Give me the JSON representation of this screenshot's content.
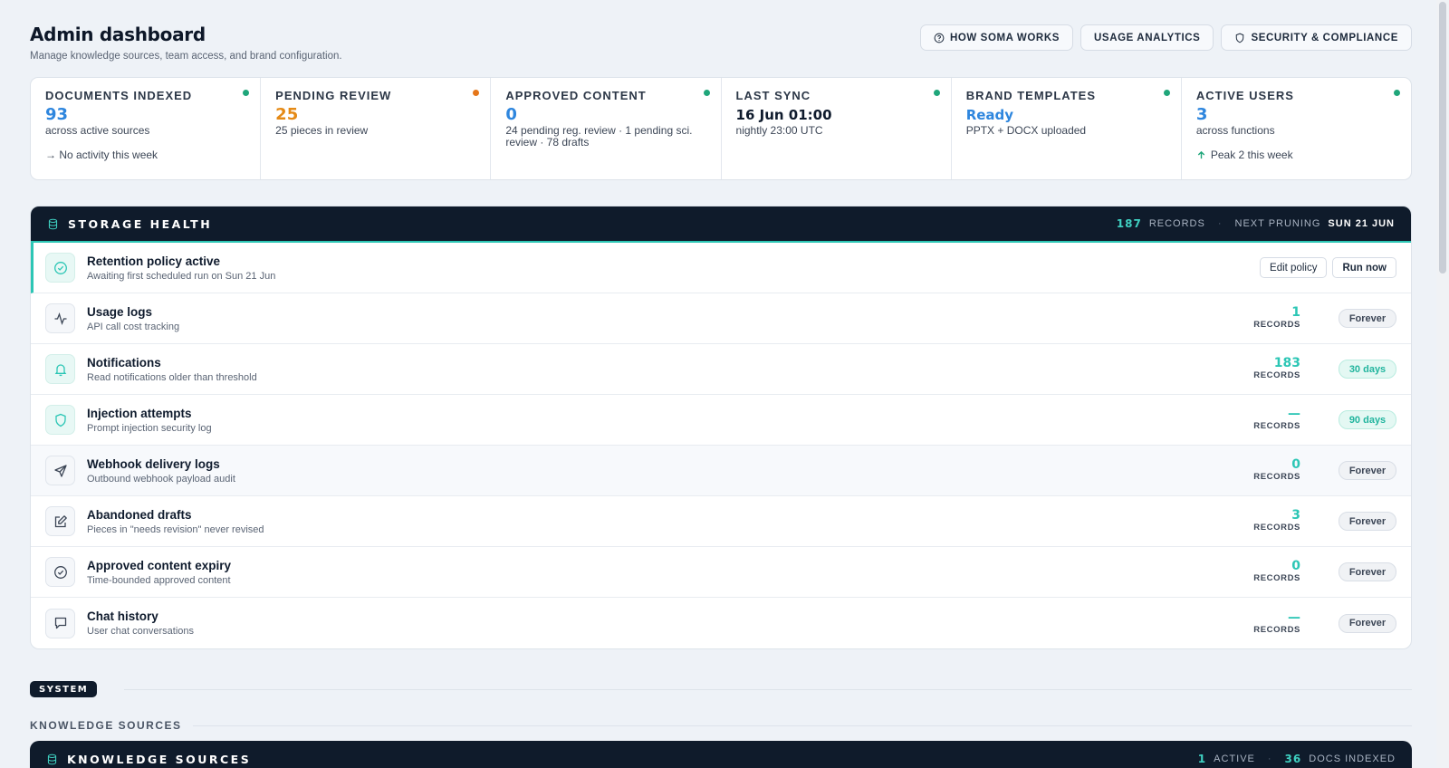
{
  "header": {
    "title": "Admin dashboard",
    "subtitle": "Manage knowledge sources, team access, and brand configuration.",
    "actions": [
      {
        "label": "HOW SOMA WORKS",
        "icon": "help-circle-icon"
      },
      {
        "label": "USAGE ANALYTICS"
      },
      {
        "label": "SECURITY & COMPLIANCE",
        "icon": "shield-icon"
      }
    ]
  },
  "stats": [
    {
      "label": "DOCUMENTS INDEXED",
      "value": "93",
      "value_color": "#2e86de",
      "dot_color": "#1fa67a",
      "sub": "across active sources",
      "foot": "→ No activity this week"
    },
    {
      "label": "PENDING REVIEW",
      "value": "25",
      "value_color": "#e58a16",
      "dot_color": "#e5761a",
      "sub": "25 pieces in review",
      "foot": ""
    },
    {
      "label": "APPROVED CONTENT",
      "value": "0",
      "value_color": "#2e86de",
      "dot_color": "#1fa67a",
      "sub": "24 pending reg. review · 1 pending sci. review · 78 drafts",
      "foot": ""
    },
    {
      "label": "LAST SYNC",
      "value": "16 Jun 01:00",
      "value_color": "#0f1b2d",
      "dot_color": "#1fa67a",
      "sub": "nightly 23:00 UTC",
      "foot": ""
    },
    {
      "label": "BRAND TEMPLATES",
      "value": "Ready",
      "value_color": "#2e86de",
      "dot_color": "#1fa67a",
      "sub": "PPTX + DOCX uploaded",
      "foot": ""
    },
    {
      "label": "ACTIVE USERS",
      "value": "3",
      "value_color": "#2e86de",
      "dot_color": "#1fa67a",
      "sub": "across functions",
      "foot": "Peak 2 this week",
      "foot_icon": "arrow-up-icon"
    }
  ],
  "storage": {
    "title": "STORAGE HEALTH",
    "records_count": "187",
    "records_label": "RECORDS",
    "next_pruning_label": "NEXT PRUNING",
    "next_pruning_value": "SUN 21 JUN",
    "policy": {
      "title": "Retention policy active",
      "desc": "Awaiting first scheduled run on Sun 21 Jun",
      "edit_label": "Edit policy",
      "run_label": "Run now"
    },
    "rows": [
      {
        "title": "Usage logs",
        "desc": "API call cost tracking",
        "count": "1",
        "rec_label": "RECORDS",
        "retention": "Forever",
        "icon": "activity-icon"
      },
      {
        "title": "Notifications",
        "desc": "Read notifications older than threshold",
        "count": "183",
        "rec_label": "RECORDS",
        "retention": "30 days",
        "icon": "bell-icon"
      },
      {
        "title": "Injection attempts",
        "desc": "Prompt injection security log",
        "count": "—",
        "rec_label": "RECORDS",
        "retention": "90 days",
        "icon": "shield-icon"
      },
      {
        "title": "Webhook delivery logs",
        "desc": "Outbound webhook payload audit",
        "count": "0",
        "rec_label": "RECORDS",
        "retention": "Forever",
        "icon": "send-icon"
      },
      {
        "title": "Abandoned drafts",
        "desc": "Pieces in \"needs revision\" never revised",
        "count": "3",
        "rec_label": "RECORDS",
        "retention": "Forever",
        "icon": "edit-icon"
      },
      {
        "title": "Approved content expiry",
        "desc": "Time-bounded approved content",
        "count": "0",
        "rec_label": "RECORDS",
        "retention": "Forever",
        "icon": "check-circle-icon"
      },
      {
        "title": "Chat history",
        "desc": "User chat conversations",
        "count": "—",
        "rec_label": "RECORDS",
        "retention": "Forever",
        "icon": "chat-icon"
      }
    ]
  },
  "system_label": "SYSTEM",
  "knowledge_label": "KNOWLEDGE SOURCES",
  "knowledge_panel": {
    "title": "KNOWLEDGE SOURCES",
    "active_count": "1",
    "active_label": "ACTIVE",
    "docs_count": "36",
    "docs_label": "DOCS INDEXED"
  }
}
